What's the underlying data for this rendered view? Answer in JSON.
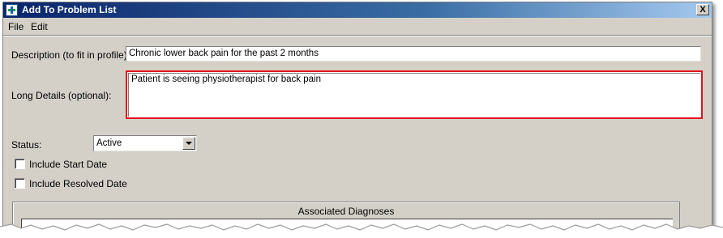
{
  "window": {
    "title": "Add To Problem List",
    "close_label": "X",
    "app_icon": "medical-cross-icon"
  },
  "menu": {
    "items": [
      "File",
      "Edit"
    ]
  },
  "form": {
    "description_label": "Description (to fit in profile):",
    "description_value": "Chronic lower back pain for the past 2 months",
    "long_details_label": "Long Details (optional):",
    "long_details_value": "Patient is seeing physiotherapist for back pain",
    "highlight_color": "#e2141b",
    "status_label": "Status:",
    "status_value": "Active",
    "include_start_date_label": "Include Start Date",
    "include_start_date_checked": false,
    "include_resolved_date_label": "Include Resolved Date",
    "include_resolved_date_checked": false
  },
  "associated_diagnoses": {
    "title": "Associated Diagnoses"
  }
}
